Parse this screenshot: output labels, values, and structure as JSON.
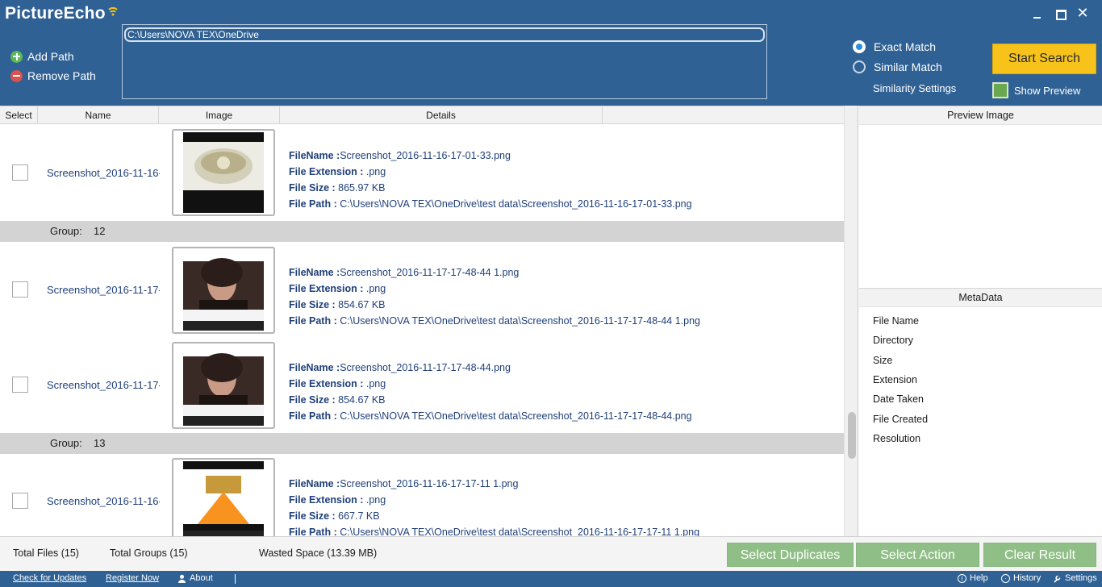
{
  "app": {
    "title_left": "Picture",
    "title_right": "Echo",
    "close_glyph": "✕"
  },
  "toolbar": {
    "add_path": "Add Path",
    "remove_path": "Remove Path",
    "path_entry": "C:\\Users\\NOVA TEX\\OneDrive",
    "exact_match": "Exact Match",
    "similar_match": "Similar Match",
    "similarity_settings": "Similarity Settings",
    "start_search": "Start Search",
    "show_preview": "Show Preview"
  },
  "grid": {
    "columns": [
      "Select",
      "Name",
      "Image",
      "Details"
    ],
    "labels": {
      "file_name": "FileName :",
      "file_extension": "File Extension :",
      "file_size": "File Size :",
      "file_path": "File Path  :"
    },
    "rows": [
      {
        "name": "Screenshot_2016-11-16-",
        "file_name": "Screenshot_2016-11-16-17-01-33.png",
        "extension": ".png",
        "size": "865.97 KB",
        "path": "C:\\Users\\NOVA TEX\\OneDrive\\test data\\Screenshot_2016-11-16-17-01-33.png"
      },
      {
        "name": "Screenshot_2016-11-17-",
        "file_name": "Screenshot_2016-11-17-17-48-44 1.png",
        "extension": ".png",
        "size": "854.67 KB",
        "path": "C:\\Users\\NOVA TEX\\OneDrive\\test data\\Screenshot_2016-11-17-17-48-44 1.png"
      },
      {
        "name": "Screenshot_2016-11-17-",
        "file_name": "Screenshot_2016-11-17-17-48-44.png",
        "extension": ".png",
        "size": "854.67 KB",
        "path": "C:\\Users\\NOVA TEX\\OneDrive\\test data\\Screenshot_2016-11-17-17-48-44.png"
      },
      {
        "name": "Screenshot_2016-11-16-",
        "file_name": "Screenshot_2016-11-16-17-17-11 1.png",
        "extension": ".png",
        "size": "667.7 KB",
        "path": "C:\\Users\\NOVA TEX\\OneDrive\\test data\\Screenshot_2016-11-16-17-17-11 1.png"
      }
    ],
    "groups": [
      {
        "label": "Group:",
        "number": "12"
      },
      {
        "label": "Group:",
        "number": "13"
      }
    ]
  },
  "preview": {
    "title": "Preview Image",
    "metadata_title": "MetaData",
    "metadata_fields": [
      "File Name",
      "Directory",
      "Size",
      "Extension",
      "Date Taken",
      "File Created",
      "Resolution"
    ]
  },
  "status": {
    "total_files": "Total Files (15)",
    "total_groups": "Total Groups (15)",
    "wasted_space": "Wasted Space (13.39 MB)",
    "select_duplicates": "Select Duplicates",
    "select_action": "Select Action",
    "clear_result": "Clear Result"
  },
  "footer": {
    "check_updates": "Check for Updates",
    "register_now": "Register Now",
    "about": "About",
    "help": "Help",
    "history": "History",
    "settings": "Settings"
  },
  "colors": {
    "header_bg": "#2f6194",
    "start_button": "#f7c31a",
    "bottom_buttons": "#8fbf86",
    "link_text": "#1f3f7a",
    "group_bg": "#d3d3d3"
  }
}
